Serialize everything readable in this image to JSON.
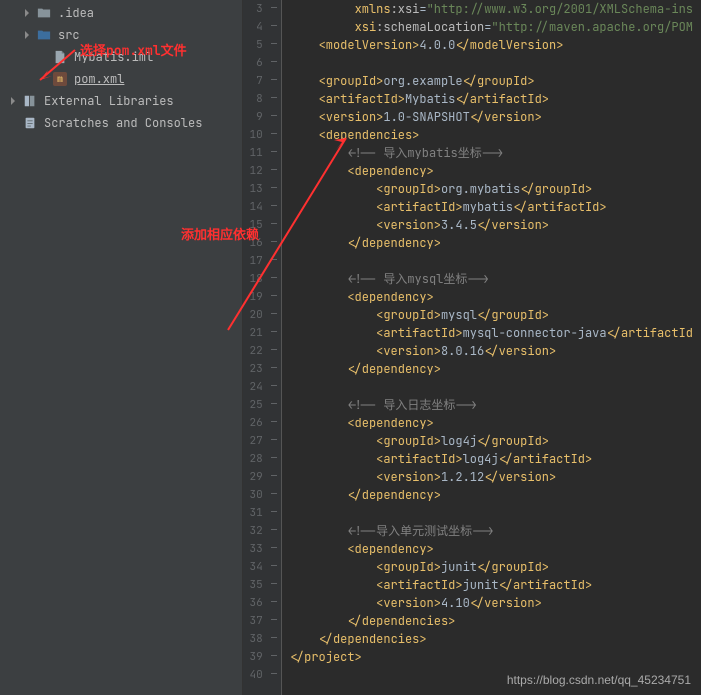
{
  "sidebar": {
    "items": [
      {
        "label": ".idea",
        "icon": "folder",
        "arrow": true,
        "indent": 1
      },
      {
        "label": "src",
        "icon": "src-folder",
        "arrow": true,
        "indent": 1
      },
      {
        "label": "Mybatis.iml",
        "icon": "file",
        "arrow": false,
        "indent": 2
      },
      {
        "label": "pom.xml",
        "icon": "maven",
        "arrow": false,
        "indent": 2,
        "underline": true
      },
      {
        "label": "External Libraries",
        "icon": "lib",
        "arrow": true,
        "indent": 0
      },
      {
        "label": "Scratches and Consoles",
        "icon": "scratch",
        "arrow": false,
        "indent": 0
      }
    ]
  },
  "annotations": {
    "select_pom": "选择pom.xml文件",
    "add_deps": "添加相应依赖"
  },
  "watermark": "https://blog.csdn.net/qq_45234751",
  "gutter_start": 3,
  "gutter_end": 40,
  "code": [
    {
      "indent": 9,
      "parts": [
        {
          "t": "ns",
          "v": "xmlns"
        },
        {
          "t": "attr",
          "v": ":xsi"
        },
        {
          "t": "text",
          "v": "="
        },
        {
          "t": "val",
          "v": "\"http://www.w3.org/2001/XMLSchema-ins"
        }
      ]
    },
    {
      "indent": 9,
      "parts": [
        {
          "t": "ns",
          "v": "xsi"
        },
        {
          "t": "attr",
          "v": ":schemaLocation"
        },
        {
          "t": "text",
          "v": "="
        },
        {
          "t": "val",
          "v": "\"http://maven.apache.org/POM"
        }
      ]
    },
    {
      "indent": 4,
      "parts": [
        {
          "t": "tag",
          "v": "<modelVersion>"
        },
        {
          "t": "text",
          "v": "4.0.0"
        },
        {
          "t": "tag",
          "v": "</modelVersion>"
        }
      ]
    },
    {
      "indent": 0,
      "parts": []
    },
    {
      "indent": 4,
      "parts": [
        {
          "t": "tag",
          "v": "<groupId>"
        },
        {
          "t": "text",
          "v": "org.example"
        },
        {
          "t": "tag",
          "v": "</groupId>"
        }
      ]
    },
    {
      "indent": 4,
      "parts": [
        {
          "t": "tag",
          "v": "<artifactId>"
        },
        {
          "t": "text",
          "v": "Mybatis"
        },
        {
          "t": "tag",
          "v": "</artifactId>"
        }
      ]
    },
    {
      "indent": 4,
      "parts": [
        {
          "t": "tag",
          "v": "<version>"
        },
        {
          "t": "text",
          "v": "1.0-SNAPSHOT"
        },
        {
          "t": "tag",
          "v": "</version>"
        }
      ]
    },
    {
      "indent": 4,
      "parts": [
        {
          "t": "tag",
          "v": "<dependencies>"
        }
      ]
    },
    {
      "indent": 8,
      "parts": [
        {
          "t": "comment",
          "v": "<!-- 导入mybatis坐标-->"
        }
      ]
    },
    {
      "indent": 8,
      "parts": [
        {
          "t": "tag",
          "v": "<dependency>"
        }
      ]
    },
    {
      "indent": 12,
      "parts": [
        {
          "t": "tag",
          "v": "<groupId>"
        },
        {
          "t": "text",
          "v": "org.mybatis"
        },
        {
          "t": "tag",
          "v": "</groupId>"
        }
      ]
    },
    {
      "indent": 12,
      "parts": [
        {
          "t": "tag",
          "v": "<artifactId>"
        },
        {
          "t": "text",
          "v": "mybatis"
        },
        {
          "t": "tag",
          "v": "</artifactId>"
        }
      ]
    },
    {
      "indent": 12,
      "parts": [
        {
          "t": "tag",
          "v": "<version>"
        },
        {
          "t": "text",
          "v": "3.4.5"
        },
        {
          "t": "tag",
          "v": "</version>"
        }
      ]
    },
    {
      "indent": 8,
      "parts": [
        {
          "t": "tag",
          "v": "</dependency>"
        }
      ]
    },
    {
      "indent": 0,
      "parts": []
    },
    {
      "indent": 8,
      "parts": [
        {
          "t": "comment",
          "v": "<!-- 导入mysql坐标-->"
        }
      ]
    },
    {
      "indent": 8,
      "parts": [
        {
          "t": "tag",
          "v": "<dependency>"
        }
      ]
    },
    {
      "indent": 12,
      "parts": [
        {
          "t": "tag",
          "v": "<groupId>"
        },
        {
          "t": "text",
          "v": "mysql"
        },
        {
          "t": "tag",
          "v": "</groupId>"
        }
      ]
    },
    {
      "indent": 12,
      "parts": [
        {
          "t": "tag",
          "v": "<artifactId>"
        },
        {
          "t": "text",
          "v": "mysql-connector-java"
        },
        {
          "t": "tag",
          "v": "</artifactId"
        }
      ]
    },
    {
      "indent": 12,
      "parts": [
        {
          "t": "tag",
          "v": "<version>"
        },
        {
          "t": "text",
          "v": "8.0.16"
        },
        {
          "t": "tag",
          "v": "</version>"
        }
      ]
    },
    {
      "indent": 8,
      "parts": [
        {
          "t": "tag",
          "v": "</dependency>"
        }
      ]
    },
    {
      "indent": 0,
      "parts": []
    },
    {
      "indent": 8,
      "parts": [
        {
          "t": "comment",
          "v": "<!-- 导入日志坐标-->"
        }
      ]
    },
    {
      "indent": 8,
      "parts": [
        {
          "t": "tag",
          "v": "<dependency>"
        }
      ]
    },
    {
      "indent": 12,
      "parts": [
        {
          "t": "tag",
          "v": "<groupId>"
        },
        {
          "t": "text",
          "v": "log4j"
        },
        {
          "t": "tag",
          "v": "</groupId>"
        }
      ]
    },
    {
      "indent": 12,
      "parts": [
        {
          "t": "tag",
          "v": "<artifactId>"
        },
        {
          "t": "text",
          "v": "log4j"
        },
        {
          "t": "tag",
          "v": "</artifactId>"
        }
      ]
    },
    {
      "indent": 12,
      "parts": [
        {
          "t": "tag",
          "v": "<version>"
        },
        {
          "t": "text",
          "v": "1.2.12"
        },
        {
          "t": "tag",
          "v": "</version>"
        }
      ]
    },
    {
      "indent": 8,
      "parts": [
        {
          "t": "tag",
          "v": "</dependency>"
        }
      ]
    },
    {
      "indent": 0,
      "parts": []
    },
    {
      "indent": 8,
      "parts": [
        {
          "t": "comment",
          "v": "<!--导入单元测试坐标-->"
        }
      ]
    },
    {
      "indent": 8,
      "parts": [
        {
          "t": "tag",
          "v": "<dependency>"
        }
      ]
    },
    {
      "indent": 12,
      "parts": [
        {
          "t": "tag",
          "v": "<groupId>"
        },
        {
          "t": "text",
          "v": "junit"
        },
        {
          "t": "tag",
          "v": "</groupId>"
        }
      ]
    },
    {
      "indent": 12,
      "parts": [
        {
          "t": "tag",
          "v": "<artifactId>"
        },
        {
          "t": "text",
          "v": "junit"
        },
        {
          "t": "tag",
          "v": "</artifactId>"
        }
      ]
    },
    {
      "indent": 12,
      "parts": [
        {
          "t": "tag",
          "v": "<version>"
        },
        {
          "t": "text",
          "v": "4.10"
        },
        {
          "t": "tag",
          "v": "</version>"
        }
      ]
    },
    {
      "indent": 8,
      "parts": [
        {
          "t": "tag",
          "v": "</dependencies>"
        }
      ]
    },
    {
      "indent": 4,
      "parts": [
        {
          "t": "tag",
          "v": "</dependencies>"
        }
      ]
    },
    {
      "indent": 0,
      "parts": [
        {
          "t": "tag",
          "v": "</project>"
        }
      ]
    },
    {
      "indent": 0,
      "parts": []
    }
  ]
}
